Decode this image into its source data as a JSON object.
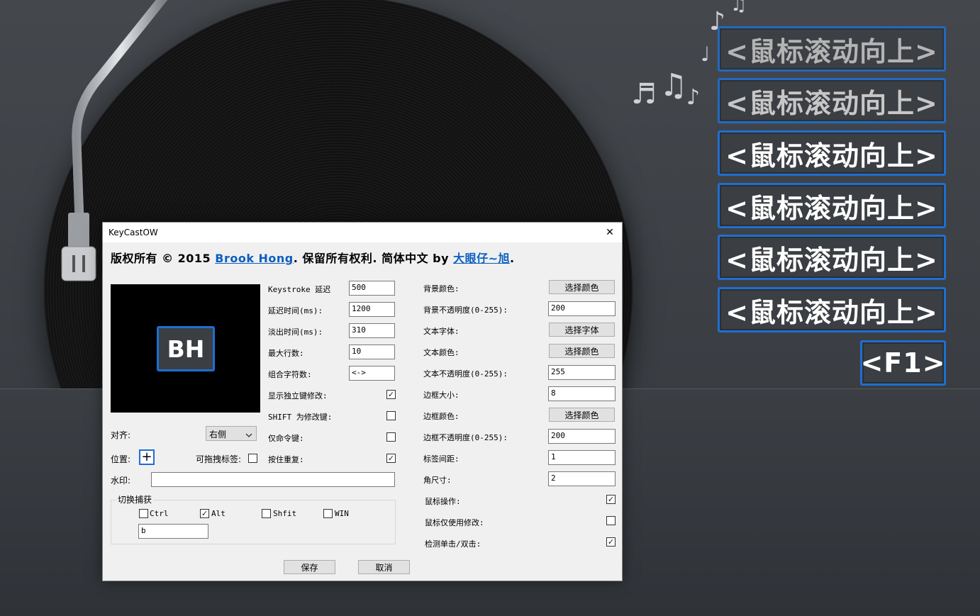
{
  "desktop": {
    "key_labels": [
      {
        "text": "<鼠标滚动向上>",
        "faded": true
      },
      {
        "text": "<鼠标滚动向上>",
        "faded": true
      },
      {
        "text": "<鼠标滚动向上>",
        "faded": false
      },
      {
        "text": "<鼠标滚动向上>",
        "faded": false
      },
      {
        "text": "<鼠标滚动向上>",
        "faded": false
      },
      {
        "text": "<鼠标滚动向上>",
        "faded": false
      },
      {
        "text": "<F1>",
        "faded": false
      }
    ],
    "accent_color": "#1e6fd0"
  },
  "dialog": {
    "title": "KeyCastOW",
    "close_glyph": "✕",
    "copyright": {
      "prefix": "版权所有 © 2015 ",
      "author": "Brook Hong",
      "middle": ". 保留所有权利. 简体中文 by ",
      "translator": "大眼仔~旭",
      "suffix": "."
    },
    "preview_text": "BH",
    "left_fields": [
      {
        "label": "Keystroke 延迟",
        "value": "500"
      },
      {
        "label": "延迟时间(ms):",
        "value": "1200"
      },
      {
        "label": "淡出时间(ms):",
        "value": "310"
      },
      {
        "label": "最大行数:",
        "value": "10"
      },
      {
        "label": "组合字符数:",
        "value": "<->"
      }
    ],
    "left_checks": [
      {
        "label": "显示独立键修改:",
        "checked": true
      },
      {
        "label": "SHIFT 为修改键:",
        "checked": false
      },
      {
        "label": "仅命令键:",
        "checked": false
      },
      {
        "label": "按住重复:",
        "checked": true
      }
    ],
    "align": {
      "label": "对齐:",
      "value": "右侧"
    },
    "position": {
      "label": "位置:",
      "glyph": "+"
    },
    "draggable": {
      "label": "可拖拽标签:",
      "checked": false
    },
    "watermark": {
      "label": "水印:",
      "value": ""
    },
    "toggle_capture": {
      "title": "切换捕获",
      "mods": [
        {
          "label": "Ctrl",
          "checked": false
        },
        {
          "label": "Alt",
          "checked": true
        },
        {
          "label": "Shfit",
          "checked": false
        },
        {
          "label": "WIN",
          "checked": false
        }
      ],
      "key": "b"
    },
    "right_rows": [
      {
        "label": "背景颜色:",
        "kind": "button",
        "value": "选择颜色"
      },
      {
        "label": "背景不透明度(0-255):",
        "kind": "field",
        "value": "200"
      },
      {
        "label": "文本字体:",
        "kind": "button",
        "value": "选择字体"
      },
      {
        "label": "文本颜色:",
        "kind": "button",
        "value": "选择颜色"
      },
      {
        "label": "文本不透明度(0-255):",
        "kind": "field",
        "value": "255"
      },
      {
        "label": "边框大小:",
        "kind": "field",
        "value": "8"
      },
      {
        "label": "边框颜色:",
        "kind": "button",
        "value": "选择颜色"
      },
      {
        "label": "边框不透明度(0-255):",
        "kind": "field",
        "value": "200"
      },
      {
        "label": "标签间距:",
        "kind": "field",
        "value": "1"
      },
      {
        "label": "角尺寸:",
        "kind": "field",
        "value": "2"
      }
    ],
    "right_checks": [
      {
        "label": "鼠标操作:",
        "checked": true
      },
      {
        "label": "鼠标仅使用修改:",
        "checked": false
      },
      {
        "label": "检测单击/双击:",
        "checked": true
      }
    ],
    "save_label": "保存",
    "cancel_label": "取消",
    "check_glyph": "✓"
  }
}
